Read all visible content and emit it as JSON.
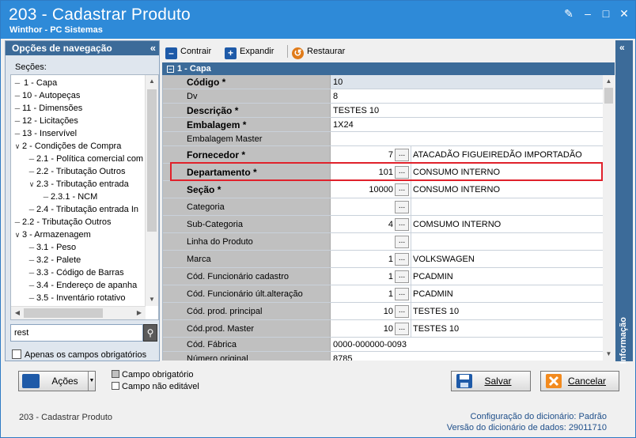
{
  "window": {
    "title": "203 - Cadastrar  Produto",
    "subtitle": "Winthor - PC Sistemas"
  },
  "nav_panel": {
    "title": "Opções de navegação",
    "sections_label": "Seções:",
    "tree": [
      {
        "label": "1 - Capa",
        "selected": true
      },
      {
        "label": "10 - Autopeças"
      },
      {
        "label": "11 - Dimensões"
      },
      {
        "label": "12 - Licitações"
      },
      {
        "label": "13 - Inservível"
      },
      {
        "label": "2 - Condições de Compra"
      },
      {
        "label": "2.1 - Política comercial com"
      },
      {
        "label": "2.2 - Tributação Outros"
      },
      {
        "label": "2.3 - Tributação entrada"
      },
      {
        "label": "2.3.1 - NCM"
      },
      {
        "label": "2.4 - Tributação entrada In"
      },
      {
        "label": "2.2 - Tributação Outros"
      },
      {
        "label": "3 - Armazenagem"
      },
      {
        "label": "3.1 - Peso"
      },
      {
        "label": "3.2 - Palete"
      },
      {
        "label": "3.3 - Código de Barras"
      },
      {
        "label": "3.4 - Endereço de apanha"
      },
      {
        "label": "3.5 - Inventário rotativo"
      }
    ],
    "search_value": "rest",
    "required_only_label": "Apenas os campos obrigatórios"
  },
  "toolbar": {
    "collapse_label": "Contrair",
    "expand_label": "Expandir",
    "restore_label": "Restaurar"
  },
  "section": {
    "title": "1 - Capa"
  },
  "fields": [
    {
      "label": "Código *",
      "bold": true,
      "value": "10"
    },
    {
      "label": "Dv",
      "value": "8"
    },
    {
      "label": "Descrição *",
      "bold": true,
      "value": "TESTES 10"
    },
    {
      "label": "Embalagem *",
      "bold": true,
      "value": "1X24"
    },
    {
      "label": "Embalagem Master",
      "value": ""
    },
    {
      "label": "Fornecedor *",
      "bold": true,
      "number": "7",
      "desc": "ATACADÃO FIGUEIREDÃO IMPORTADÃO"
    },
    {
      "label": "Departamento *",
      "bold": true,
      "number": "101",
      "desc": "CONSUMO INTERNO"
    },
    {
      "label": "Seção *",
      "bold": true,
      "number": "10000",
      "desc": "CONSUMO INTERNO"
    },
    {
      "label": "Categoria",
      "number": "",
      "desc": ""
    },
    {
      "label": "Sub-Categoria",
      "number": "4",
      "desc": "COMSUMO INTERNO"
    },
    {
      "label": "Linha do Produto",
      "number": "",
      "desc": ""
    },
    {
      "label": "Marca",
      "number": "1",
      "desc": "VOLKSWAGEN"
    },
    {
      "label": "Cód. Funcionário cadastro",
      "number": "1",
      "desc": "PCADMIN"
    },
    {
      "label": "Cód. Funcionário últ.alteração",
      "number": "1",
      "desc": "PCADMIN"
    },
    {
      "label": "Cód. prod. principal",
      "number": "10",
      "desc": "TESTES 10"
    },
    {
      "label": "Cód.prod. Master",
      "number": "10",
      "desc": "TESTES 10"
    },
    {
      "label": "Cód. Fábrica",
      "value": "0000-000000-0093"
    },
    {
      "label": "Número original",
      "value": "8785"
    }
  ],
  "info_panel": {
    "label": "Informação"
  },
  "bottom": {
    "actions_label": "Ações",
    "legend_required": "Campo obrigatório",
    "legend_readonly": "Campo não editável",
    "save_label": "Salvar",
    "cancel_label": "Cancelar"
  },
  "footer": {
    "program": "203 - Cadastrar  Produto",
    "dict_config_label": "Configuração do dicionário:",
    "dict_config_value": "Padrão",
    "dict_version_label": "Versão do dicionário de dados:",
    "dict_version_value": "29011710"
  },
  "colors": {
    "titlebar": "#2e8ad8",
    "panel_header": "#3c6b99",
    "highlight": "#e0212b"
  }
}
